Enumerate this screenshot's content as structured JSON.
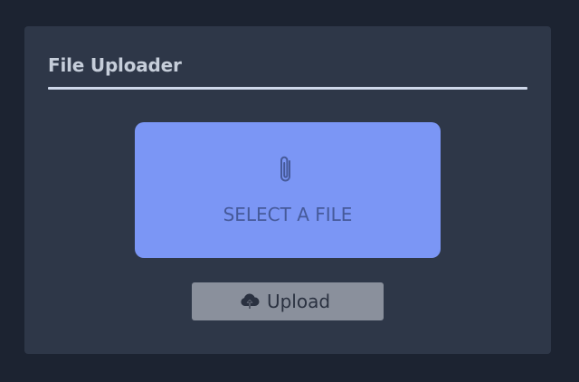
{
  "uploader": {
    "title": "File Uploader",
    "dropzone": {
      "icon": "paperclip-icon",
      "label": "SELECT A FILE"
    },
    "upload_button": {
      "icon": "cloud-upload-icon",
      "label": "Upload"
    }
  },
  "colors": {
    "page_background": "#1c2331",
    "card_background": "#2e3748",
    "accent": "#7b96f5",
    "button_disabled": "#8a909c"
  }
}
